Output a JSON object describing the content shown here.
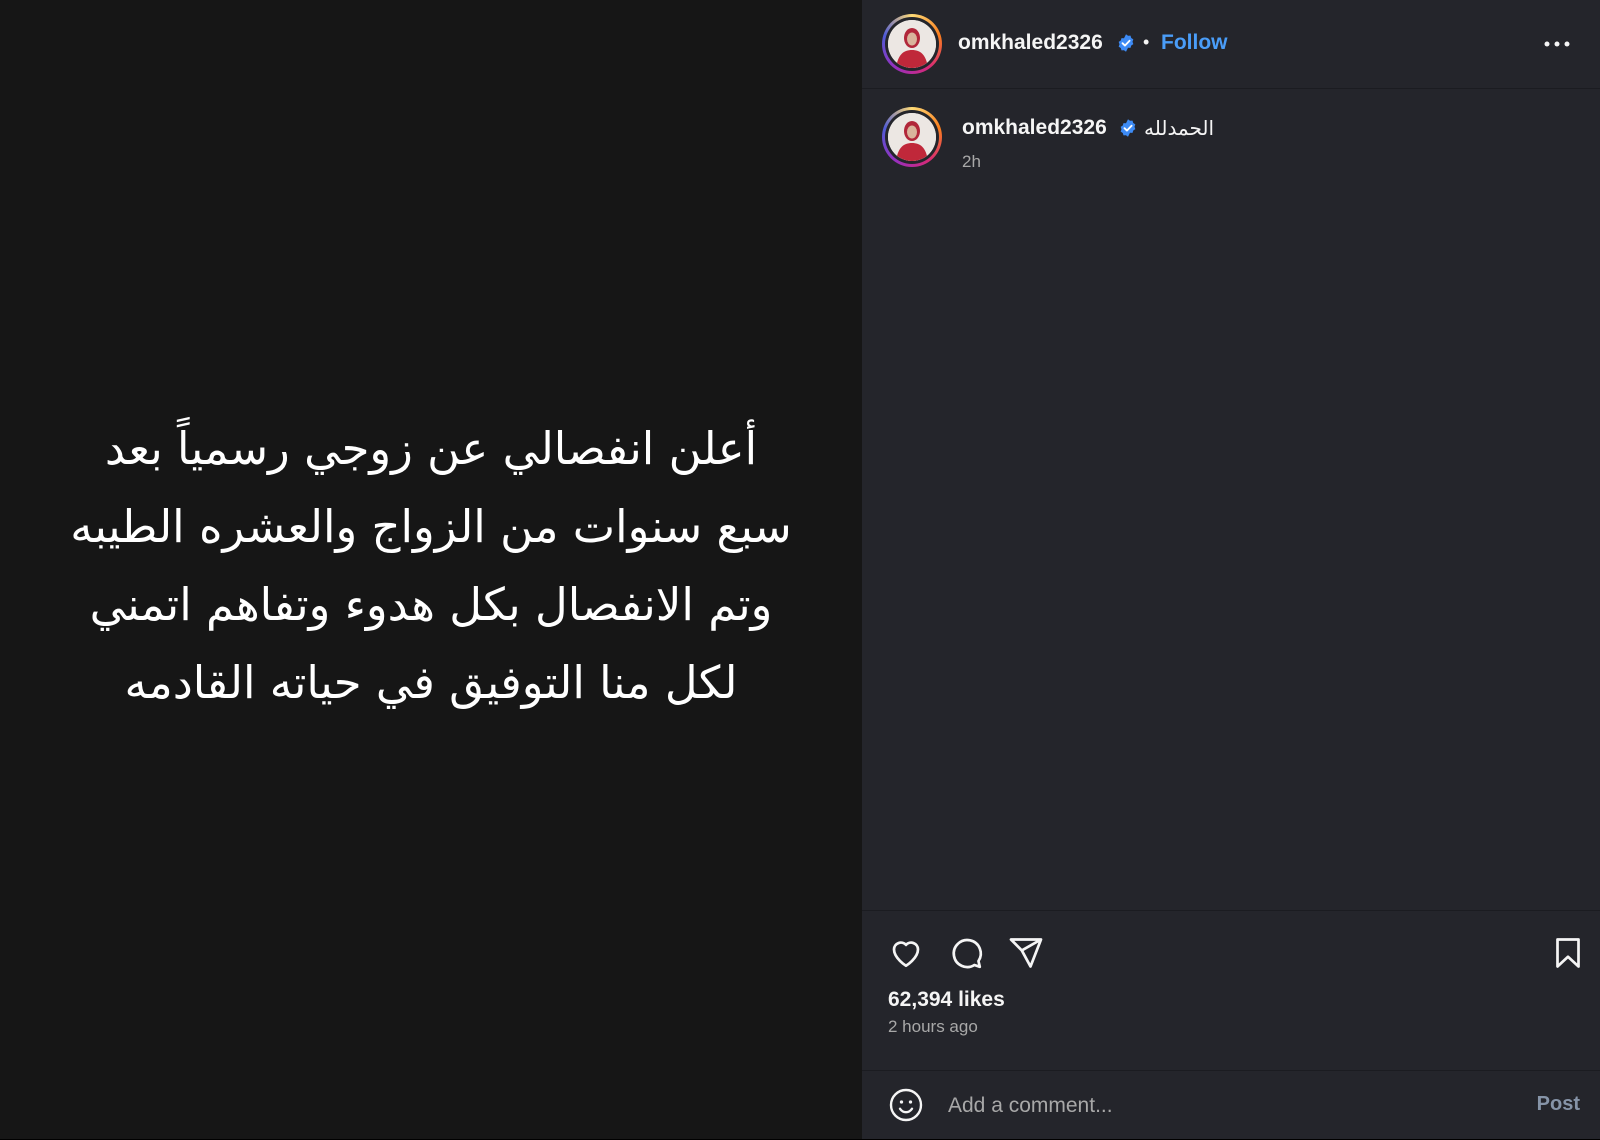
{
  "post_media": {
    "lines": [
      "أعلن انفصالي عن زوجي رسمياً بعد",
      "سبع سنوات من الزواج والعشره الطيبه",
      "وتم الانفصال بكل هدوء وتفاهم اتمني",
      "لكل منا التوفيق في حياته القادمه"
    ]
  },
  "header": {
    "username": "omkhaled2326",
    "separator": "•",
    "follow_label": "Follow"
  },
  "caption": {
    "username": "omkhaled2326",
    "text": "الحمدلله",
    "time": "2h"
  },
  "engagement": {
    "likes": "62,394 likes",
    "posted_ago": "2 hours ago"
  },
  "comment": {
    "placeholder": "Add a comment...",
    "post_label": "Post"
  },
  "colors": {
    "media_bg": "#161616",
    "panel_bg": "#24252b",
    "link_blue": "#4a9df8",
    "verified_blue": "#3d8bf5",
    "muted": "#a8a8a8"
  },
  "icons": [
    "verified-badge-icon",
    "more-options-icon",
    "heart-icon",
    "comment-icon",
    "share-icon",
    "bookmark-icon",
    "emoji-icon"
  ]
}
